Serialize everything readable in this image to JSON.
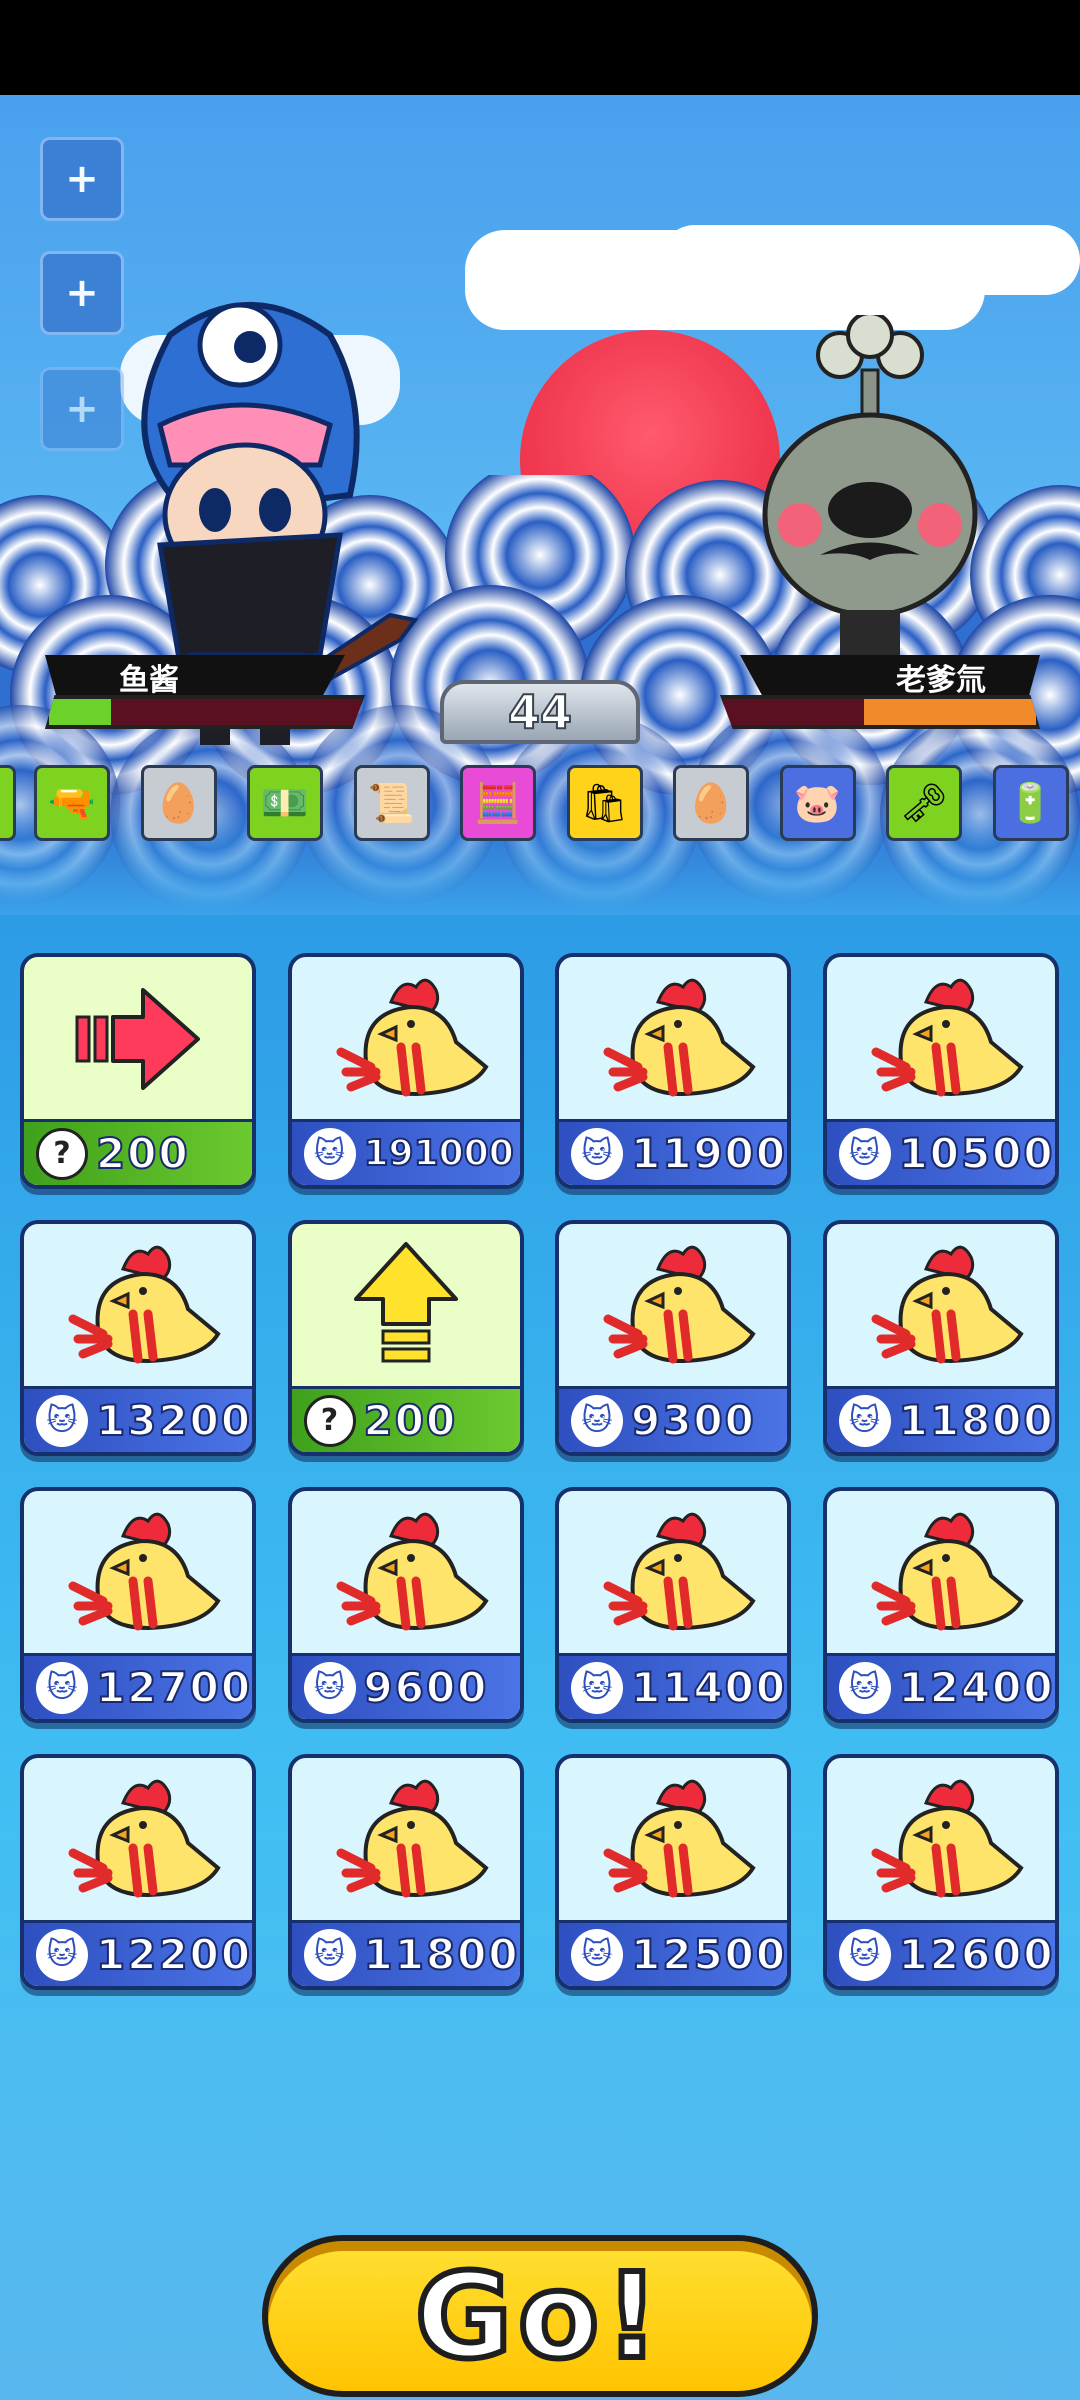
{
  "player": {
    "name": "鱼酱",
    "hp_fraction": 0.2
  },
  "opponent": {
    "name": "老爹氚",
    "hp_fraction": 0.55
  },
  "round": "44",
  "side_buttons": [
    "+",
    "+",
    "+"
  ],
  "items": [
    {
      "icon": "gun-icon",
      "glyph": "🔫",
      "bg": "#7ed321"
    },
    {
      "icon": "egg-icon",
      "glyph": "🥚",
      "bg": "#c7ccd3"
    },
    {
      "icon": "cash-icon",
      "glyph": "💵",
      "bg": "#7ed321"
    },
    {
      "icon": "scroll-icon",
      "glyph": "📜",
      "bg": "#c7ccd3"
    },
    {
      "icon": "calculator-icon",
      "glyph": "🧮",
      "bg": "#e84bd6"
    },
    {
      "icon": "bag-icon",
      "glyph": "🛍",
      "bg": "#ffd31a"
    },
    {
      "icon": "egg-icon",
      "glyph": "🥚",
      "bg": "#c7ccd3"
    },
    {
      "icon": "piggy-bank-icon",
      "glyph": "🐷",
      "bg": "#4b6fe0"
    },
    {
      "icon": "key-icon",
      "glyph": "🗝",
      "bg": "#7ed321"
    },
    {
      "icon": "battery-icon",
      "glyph": "🔋",
      "bg": "#4b6fe0"
    }
  ],
  "cards": [
    {
      "type": "arrow-right",
      "price": "200",
      "currency": "?"
    },
    {
      "type": "chicken",
      "price": "191000",
      "currency": "cat"
    },
    {
      "type": "chicken",
      "price": "11900",
      "currency": "cat"
    },
    {
      "type": "chicken",
      "price": "10500",
      "currency": "cat"
    },
    {
      "type": "chicken",
      "price": "13200",
      "currency": "cat"
    },
    {
      "type": "arrow-up",
      "price": "200",
      "currency": "?"
    },
    {
      "type": "chicken",
      "price": "9300",
      "currency": "cat"
    },
    {
      "type": "chicken",
      "price": "11800",
      "currency": "cat"
    },
    {
      "type": "chicken",
      "price": "12700",
      "currency": "cat"
    },
    {
      "type": "chicken",
      "price": "9600",
      "currency": "cat"
    },
    {
      "type": "chicken",
      "price": "11400",
      "currency": "cat"
    },
    {
      "type": "chicken",
      "price": "12400",
      "currency": "cat"
    },
    {
      "type": "chicken",
      "price": "12200",
      "currency": "cat"
    },
    {
      "type": "chicken",
      "price": "11800",
      "currency": "cat"
    },
    {
      "type": "chicken",
      "price": "12500",
      "currency": "cat"
    },
    {
      "type": "chicken",
      "price": "12600",
      "currency": "cat"
    }
  ],
  "go_label": "Go!",
  "colors": {
    "hp_player": "#6cd12a",
    "hp_opponent": "#f08a2a",
    "sun": "#f0384f"
  }
}
